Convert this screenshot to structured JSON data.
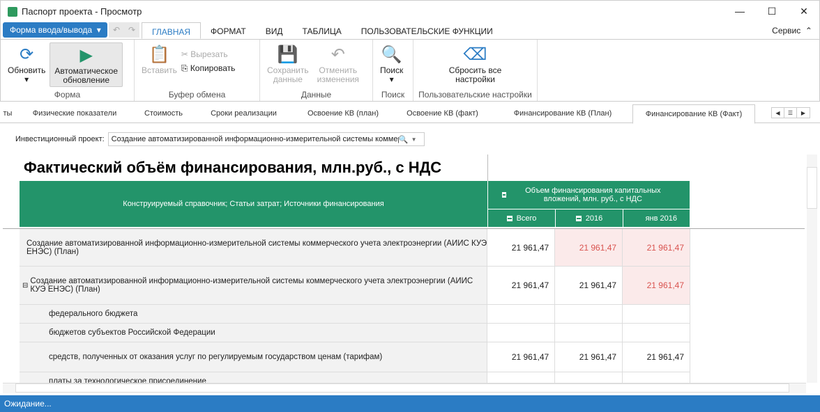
{
  "window": {
    "title": "Паспорт проекта - Просмотр"
  },
  "menu": {
    "form_button": "Форма ввода/вывода",
    "tabs": [
      "ГЛАВНАЯ",
      "ФОРМАТ",
      "ВИД",
      "ТАБЛИЦА",
      "ПОЛЬЗОВАТЕЛЬСКИЕ ФУНКЦИИ"
    ],
    "service": "Сервис"
  },
  "ribbon": {
    "refresh": "Обновить",
    "auto1": "Автоматическое",
    "auto2": "обновление",
    "group_form": "Форма",
    "paste": "Вставить",
    "cut": "Вырезать",
    "copy": "Копировать",
    "group_clipboard": "Буфер обмена",
    "save1": "Сохранить",
    "save2": "данные",
    "cancel1": "Отменить",
    "cancel2": "изменения",
    "group_data": "Данные",
    "search": "Поиск",
    "group_search": "Поиск",
    "reset1": "Сбросить все",
    "reset2": "настройки",
    "group_user": "Пользовательские настройки"
  },
  "doc_tabs": [
    "ты",
    "Физические показатели",
    "Стоимость",
    "Сроки реализации",
    "Освоение КВ (план)",
    "Освоение КВ (факт)",
    "Финансирование КВ (План)",
    "Финансирование КВ (Факт)"
  ],
  "param": {
    "label": "Инвестиционный проект:",
    "value": "Создание автоматизированной информационно-измерительной системы коммерческого учета электроэнергии"
  },
  "report": {
    "title": "Фактический объём финансирования, млн.руб., с НДС",
    "col_dim": "Конструируемый справочник; Статьи затрат; Источники финансирования",
    "col_group": "Объем финансирования капитальных вложений, млн. руб., с НДС",
    "cols": [
      "Всего",
      "2016",
      "янв 2016"
    ],
    "rows": [
      {
        "label": "Создание автоматизированной информационно-измерительной системы коммерческого учета электроэнергии (АИИС КУЭ ЕНЭС) (План)",
        "values": [
          "21 961,47",
          "21 961,47",
          "21 961,47"
        ]
      },
      {
        "label": "Создание автоматизированной информационно-измерительной системы коммерческого учета электроэнергии (АИИС КУЭ ЕНЭС) (План)",
        "values": [
          "21 961,47",
          "21 961,47",
          "21 961,47"
        ]
      },
      {
        "label": "федерального бюджета",
        "values": [
          "",
          "",
          ""
        ]
      },
      {
        "label": "бюджетов субъектов Российской Федерации",
        "values": [
          "",
          "",
          ""
        ]
      },
      {
        "label": "средств, полученных от оказания услуг по регулируемым государством ценам (тарифам)",
        "values": [
          "21 961,47",
          "21 961,47",
          "21 961,47"
        ]
      },
      {
        "label": "платы за технологическое присоединение",
        "values": [
          "",
          "",
          ""
        ]
      }
    ]
  },
  "status": "Ожидание..."
}
